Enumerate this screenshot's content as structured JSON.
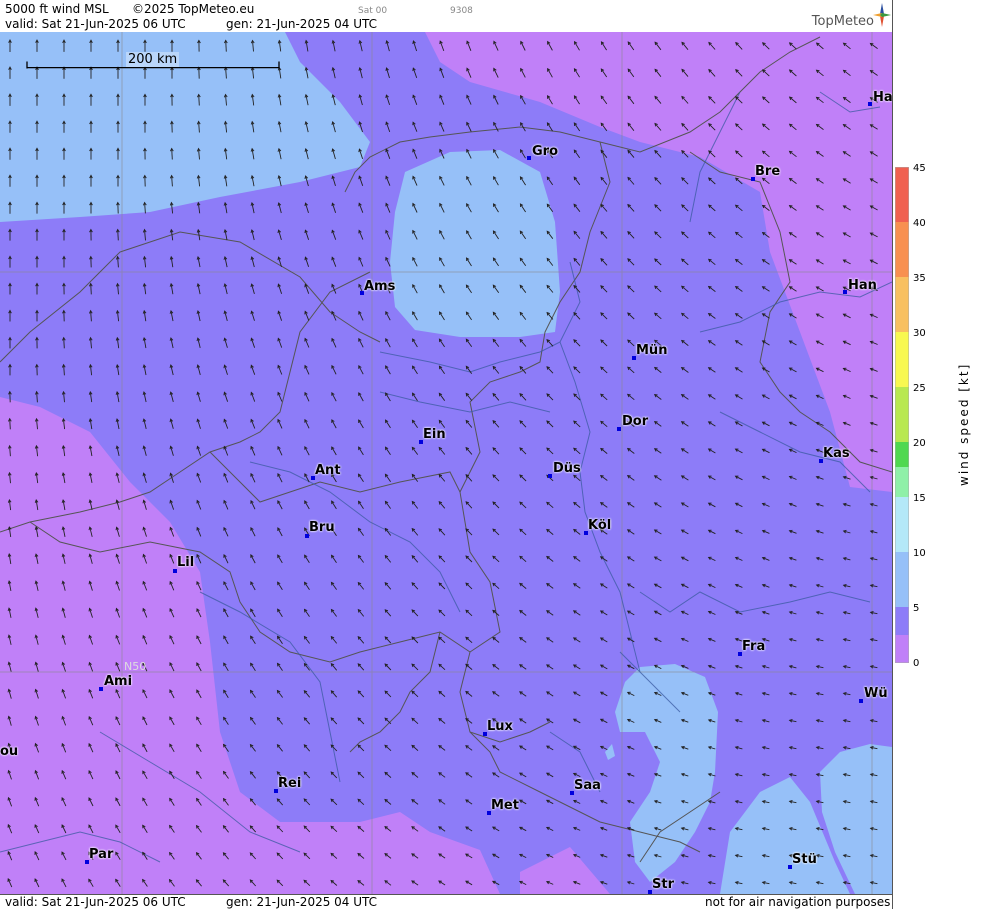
{
  "header": {
    "product": "5000 ft wind MSL",
    "copyright": "©2025 TopMeteo.eu",
    "sat": "Sat 00",
    "code": "9308",
    "valid": "valid:  Sat  21-Jun-2025  06 UTC",
    "gen": "gen: 21-Jun-2025 04 UTC",
    "brand": "TopMeteo"
  },
  "footer": {
    "valid": "valid:  Sat  21-Jun-2025  06 UTC",
    "gen": "gen: 21-Jun-2025 04 UTC",
    "disclaimer": "not for air navigation purposes"
  },
  "map": {
    "scale_label": "200 km",
    "lat_label": "N50",
    "colors": {
      "purple": "#c080f8",
      "blue": "#8d7cf8",
      "lightblue": "#96c0f8",
      "line": "#555555"
    },
    "cities": [
      {
        "name": "Ha"
      },
      {
        "name": "Gro"
      },
      {
        "name": "Bre"
      },
      {
        "name": "Ams"
      },
      {
        "name": "Han"
      },
      {
        "name": "Mün"
      },
      {
        "name": "Ein"
      },
      {
        "name": "Dor"
      },
      {
        "name": "Kas"
      },
      {
        "name": "Ant"
      },
      {
        "name": "Düs"
      },
      {
        "name": "Köl"
      },
      {
        "name": "Bru"
      },
      {
        "name": "Lil"
      },
      {
        "name": "Fra"
      },
      {
        "name": "Ami"
      },
      {
        "name": "Wü"
      },
      {
        "name": "Lux"
      },
      {
        "name": "ou"
      },
      {
        "name": "Rei"
      },
      {
        "name": "Saa"
      },
      {
        "name": "Met"
      },
      {
        "name": "Stü"
      },
      {
        "name": "Par"
      },
      {
        "name": "Str"
      }
    ]
  },
  "legend": {
    "title": "wind speed [kt]",
    "ticks": [
      "45",
      "40",
      "35",
      "30",
      "25",
      "20",
      "15",
      "10",
      "5",
      "0"
    ],
    "colors": [
      "#c080f8",
      "#8d7cf8",
      "#96c0f8",
      "#b4e8f8",
      "#8ff0a8",
      "#50d850",
      "#b8e850",
      "#f8f850",
      "#f8c060",
      "#f89050",
      "#f06050"
    ]
  }
}
